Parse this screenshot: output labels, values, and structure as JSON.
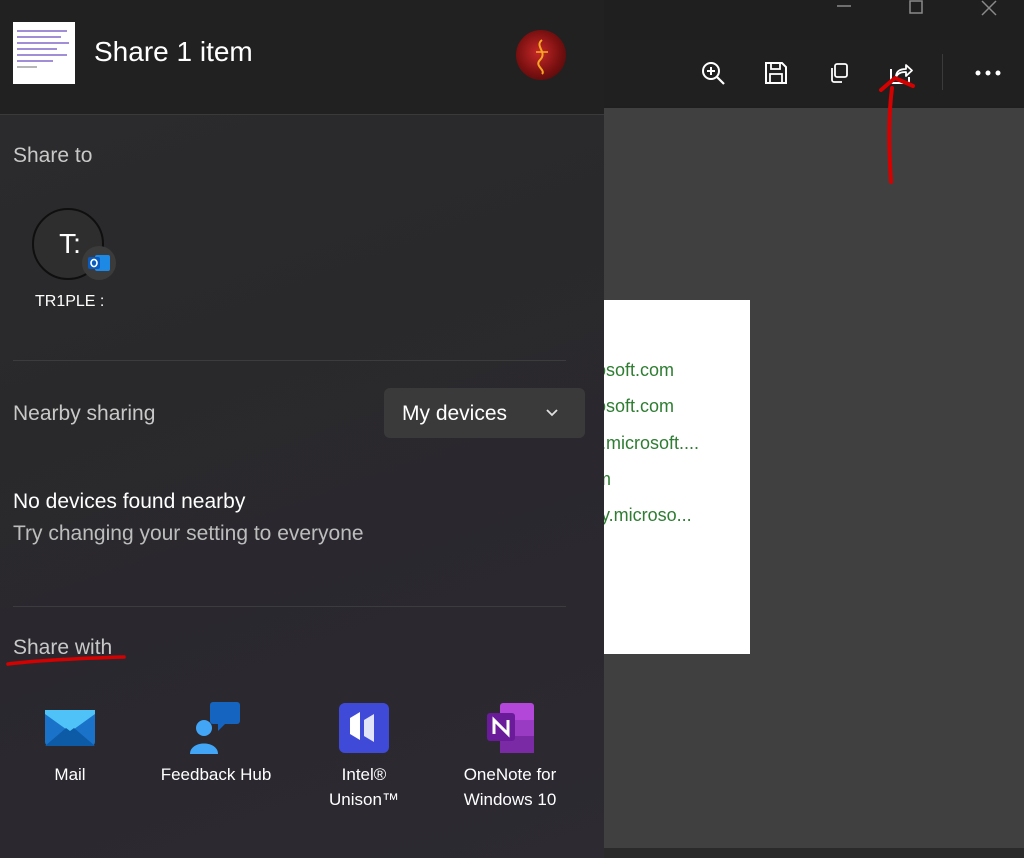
{
  "share_panel": {
    "title": "Share 1 item",
    "share_to_heading": "Share to",
    "contact": {
      "initials": "T:",
      "name": "TR1PLE :"
    },
    "nearby_heading": "Nearby sharing",
    "nearby_dropdown_value": "My devices",
    "no_devices_text": "No devices found nearby",
    "hint_text": "Try changing your setting to everyone",
    "share_with_heading": "Share with",
    "apps": [
      {
        "label": "Mail",
        "icon": "mail-icon"
      },
      {
        "label": "Feedback Hub",
        "icon": "feedback-hub-icon"
      },
      {
        "label": "Intel® Unison™",
        "icon": "intel-unison-icon"
      },
      {
        "label": "OneNote for Windows 10",
        "icon": "onenote-icon"
      }
    ]
  },
  "viewer": {
    "toolbar_icons": [
      "zoom-in-icon",
      "save-icon",
      "copy-icon",
      "share-icon",
      "more-options-icon"
    ],
    "document_lines": [
      "osoft.com",
      "osoft.com",
      "t.microsoft....",
      "m",
      "ty.microso..."
    ]
  },
  "colors": {
    "annotation_red": "#d50000",
    "link_green": "#2e7d32",
    "panel_bg": "#2b2b2d",
    "header_bg": "#212121"
  }
}
